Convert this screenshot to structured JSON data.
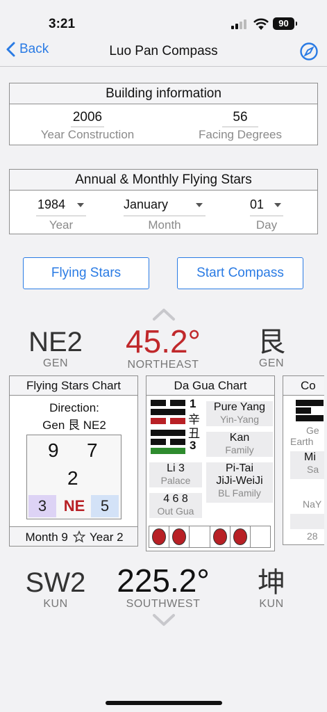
{
  "status": {
    "time": "3:21",
    "battery": "90"
  },
  "nav": {
    "back": "Back",
    "title": "Luo Pan Compass"
  },
  "building": {
    "title": "Building information",
    "year_value": "2006",
    "year_label": "Year Construction",
    "facing_value": "56",
    "facing_label": "Facing Degrees"
  },
  "annual": {
    "title": "Annual & Monthly Flying Stars",
    "year_value": "1984",
    "year_label": "Year",
    "month_value": "January",
    "month_label": "Month",
    "day_value": "01",
    "day_label": "Day"
  },
  "buttons": {
    "flying_stars": "Flying Stars",
    "start_compass": "Start Compass"
  },
  "top_reading": {
    "left_code": "NE2",
    "left_sub": "GEN",
    "degrees": "45.2°",
    "direction": "NORTHEAST",
    "right_char": "艮",
    "right_sub": "GEN",
    "degree_color": "#c0282b"
  },
  "flying_chart": {
    "title": "Flying Stars Chart",
    "direction_label": "Direction:",
    "direction_value": "Gen 艮 NE2",
    "top_left": "9",
    "top_right": "7",
    "center": "2",
    "bottom_left": "3",
    "bottom_mid": "NE",
    "bottom_right": "5",
    "footer_month": "Month 9",
    "footer_year": "Year 2",
    "colors": {
      "purple": "#ddd3f5",
      "blue": "#d3e2f7",
      "red": "#b82025"
    }
  },
  "dagua": {
    "title": "Da Gua Chart",
    "nums": {
      "n1": "1",
      "c1": "辛",
      "c2": "丑",
      "n3": "3"
    },
    "pure_yang": "Pure Yang",
    "yin_yang": "Yin-Yang",
    "kan": "Kan",
    "family": "Family",
    "li": "Li 3",
    "palace": "Palace",
    "pitai": "Pi-Tai",
    "jiji": "JiJi-WeiJi",
    "bl_family": "BL Family",
    "outgua_num": "4 6 8",
    "outgua": "Out Gua",
    "circles": [
      true,
      true,
      false,
      true,
      true,
      false
    ],
    "colors": {
      "red_bar": "#b82025",
      "green_bar": "#2e8b2e"
    }
  },
  "third_card": {
    "title": "Co",
    "ge": "Ge",
    "earth": "Earth",
    "mi": "Mi",
    "sa": "Sa",
    "nay": "NaY",
    "num": "28"
  },
  "bottom_reading": {
    "left_code": "SW2",
    "left_sub": "KUN",
    "degrees": "225.2°",
    "direction": "SOUTHWEST",
    "right_char": "坤",
    "right_sub": "KUN"
  }
}
